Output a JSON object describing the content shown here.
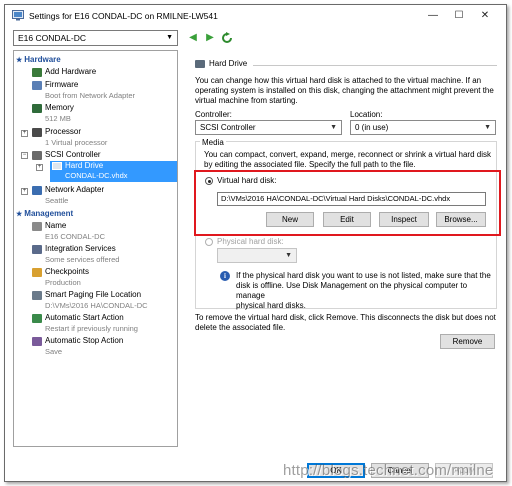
{
  "window": {
    "title": "Settings for E16 CONDAL-DC on RMILNE-LW541",
    "minimize_glyph": "—",
    "maximize_glyph": "☐",
    "close_glyph": "✕"
  },
  "toolbar": {
    "vm_selected": "E16 CONDAL-DC",
    "back_icon": "back-arrow-icon",
    "forward_icon": "forward-arrow-icon",
    "refresh_icon": "refresh-icon"
  },
  "sidebar": {
    "hardware_header": "Hardware",
    "management_header": "Management",
    "hardware_items": [
      {
        "label": "Add Hardware",
        "sub": "",
        "icon": "add-hardware-icon"
      },
      {
        "label": "Firmware",
        "sub": "Boot from Network Adapter",
        "icon": "firmware-icon"
      },
      {
        "label": "Memory",
        "sub": "512 MB",
        "icon": "memory-icon"
      },
      {
        "label": "Processor",
        "sub": "1 Virtual processor",
        "icon": "processor-icon"
      },
      {
        "label": "SCSI Controller",
        "sub": "",
        "icon": "scsi-controller-icon"
      },
      {
        "label": "Hard Drive",
        "sub": "CONDAL-DC.vhdx",
        "icon": "hard-drive-icon"
      },
      {
        "label": "Network Adapter",
        "sub": "Seattle",
        "icon": "network-adapter-icon"
      }
    ],
    "management_items": [
      {
        "label": "Name",
        "sub": "E16 CONDAL-DC",
        "icon": "name-icon"
      },
      {
        "label": "Integration Services",
        "sub": "Some services offered",
        "icon": "integration-services-icon"
      },
      {
        "label": "Checkpoints",
        "sub": "Production",
        "icon": "checkpoints-icon"
      },
      {
        "label": "Smart Paging File Location",
        "sub": "D:\\VMs\\2016 HA\\CONDAL-DC",
        "icon": "smart-paging-icon"
      },
      {
        "label": "Automatic Start Action",
        "sub": "Restart if previously running",
        "icon": "auto-start-icon"
      },
      {
        "label": "Automatic Stop Action",
        "sub": "Save",
        "icon": "auto-stop-icon"
      }
    ]
  },
  "main": {
    "section_title": "Hard Drive",
    "intro": [
      "You can change how this virtual hard disk is attached to the virtual machine. If an",
      "operating system is installed on this disk, changing the attachment might prevent the",
      "virtual machine from starting."
    ],
    "controller_label": "Controller:",
    "controller_value": "SCSI Controller",
    "location_label": "Location:",
    "location_value": "0 (in use)",
    "media_label": "Media",
    "media_desc": [
      "You can compact, convert, expand, merge, reconnect or shrink a virtual hard disk",
      "by editing the associated file. Specify the full path to the file."
    ],
    "vhd_label": "Virtual hard disk:",
    "vhd_path": "D:\\VMs\\2016 HA\\CONDAL-DC\\Virtual Hard Disks\\CONDAL-DC.vhdx",
    "buttons": {
      "new": "New",
      "edit": "Edit",
      "inspect": "Inspect",
      "browse": "Browse..."
    },
    "physical_label": "Physical hard disk:",
    "physical_value": "",
    "physical_info": [
      "If the physical hard disk you want to use is not listed, make sure that the",
      "disk is offline. Use Disk Management on the physical computer to manage",
      "physical hard disks."
    ],
    "remove_desc": [
      "To remove the virtual hard disk, click Remove. This disconnects the disk but does not",
      "delete the associated file."
    ],
    "remove_label": "Remove"
  },
  "footer": {
    "ok": "OK",
    "cancel": "Cancel",
    "apply": "Apply"
  },
  "watermark": "http://blogs.technet.com/rmilne",
  "colors": {
    "accent": "#0078d7",
    "selection": "#3399ff",
    "section_header": "#1f4e9a",
    "highlight_box": "#e0181e"
  }
}
